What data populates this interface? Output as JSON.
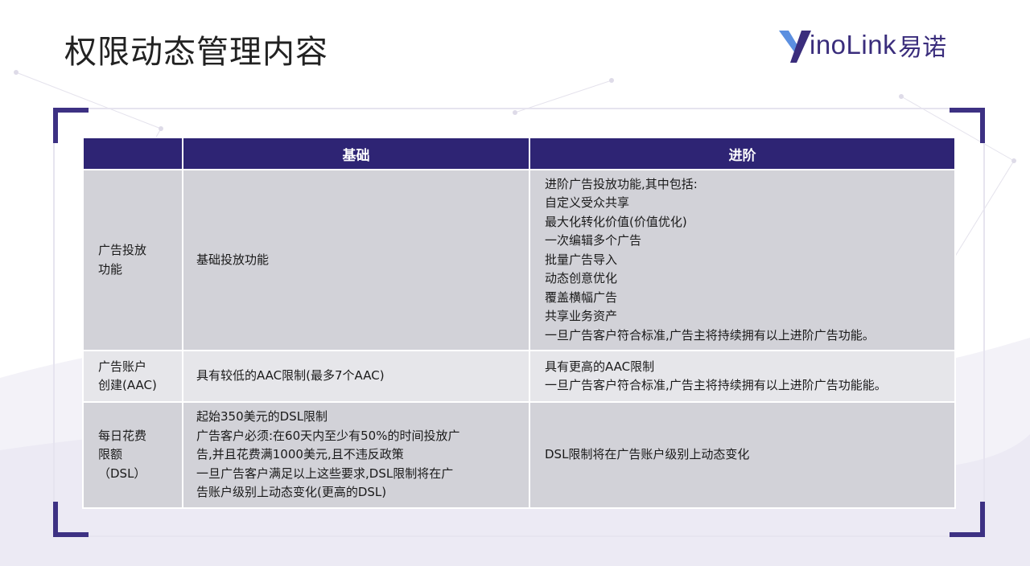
{
  "page": {
    "title": "权限动态管理内容"
  },
  "brand": {
    "logo_text": "inoLink",
    "logo_cn": "易诺",
    "accent": "#3a2d7c",
    "mark_color_light": "#5b8fe0"
  },
  "table": {
    "headers": [
      "",
      "基础",
      "进阶"
    ],
    "header_color": "#2e2474",
    "rows": [
      {
        "head": [
          "广告投放",
          "功能"
        ],
        "basic": [
          "基础投放功能"
        ],
        "advanced": [
          "进阶广告投放功能,其中包括:",
          "自定义受众共享",
          "最大化转化价值(价值优化)",
          "一次编辑多个广告",
          "批量广告导入",
          "动态创意优化",
          "覆盖横幅广告",
          "共享业务资产",
          "一旦广告客户符合标准,广告主将持续拥有以上进阶广告功能。"
        ]
      },
      {
        "head": [
          "广告账户",
          "创建(AAC)"
        ],
        "basic": [
          "具有较低的AAC限制(最多7个AAC)"
        ],
        "advanced": [
          "具有更高的AAC限制",
          "一旦广告客户符合标准,广告主将持续拥有以上进阶广告功能能。"
        ]
      },
      {
        "head": [
          "每日花费",
          "限额",
          "（DSL）"
        ],
        "basic": [
          "起始350美元的DSL限制",
          "广告客户必须:在60天内至少有50%的时间投放广",
          "告,并且花费满1000美元,且不违反政策",
          "一旦广告客户满足以上这些要求,DSL限制将在广",
          "告账户级别上动态变化(更高的DSL)"
        ],
        "advanced": [
          "DSL限制将在广告账户级别上动态变化"
        ]
      }
    ]
  }
}
